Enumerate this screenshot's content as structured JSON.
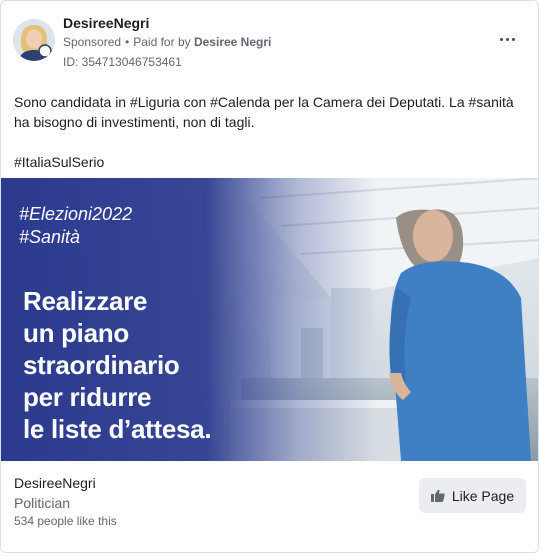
{
  "post": {
    "page_name": "DesireeNegri",
    "sponsored_label": "Sponsored",
    "paid_for_prefix": "Paid for by",
    "paid_for_name": "Desiree Negri",
    "ad_id": "ID: 354713046753461",
    "body_text": "Sono candidata in #Liguria con #Calenda per la Camera dei Deputati. La #sanità ha bisogno di investimenti, non di tagli.",
    "body_hashtag": "#ItaliaSulSerio",
    "more_icon": "more-horizontal-icon"
  },
  "creative": {
    "tags": [
      "#Elezioni2022",
      "#Sanità"
    ],
    "headline_lines": [
      "Realizzare",
      "un piano",
      "straordinario",
      "per ridurre",
      "le liste d’attesa."
    ],
    "accent_color": "#2b3a8e"
  },
  "footer": {
    "page_name": "DesireeNegri",
    "category": "Politician",
    "likes": "534 people like this",
    "like_button_label": "Like Page",
    "like_icon": "thumbs-up-icon"
  }
}
